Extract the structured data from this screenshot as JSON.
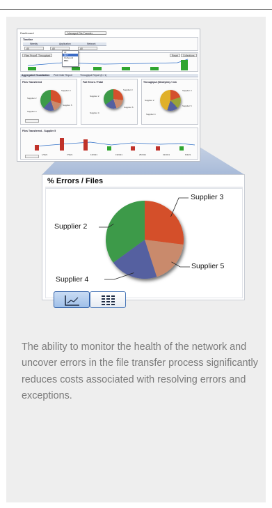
{
  "mini_dashboard": {
    "dashboard_label": "Dashboard",
    "dashboard_value": "Managed File Transfer",
    "timeline_label": "Timeline",
    "filter_tabs": [
      "Weekly",
      "Application",
      "Network"
    ],
    "filter_selects": [
      "All",
      "All",
      "All"
    ],
    "dropdown_options": [
      "All",
      "MFT",
      "Outbound Files",
      "EDI"
    ],
    "chart_tabs": [
      "Files Processed",
      "Throughput"
    ],
    "chart_chips": [
      "Reset",
      "Collections"
    ],
    "section_tabs": [
      "Aggregated Visualization",
      "Ped Order Report",
      "Throughput Report (6 / 1)"
    ],
    "pie_titles": [
      "Files Transferred",
      "Full Errors / Fatal",
      "Throughput (Kilobytes) / min"
    ],
    "pie_labels": [
      "Supplier 2",
      "Supplier 3",
      "Supplier 4",
      "Supplier 5"
    ],
    "bottom_title": "Files Transferred - Supplier 5",
    "bottom_ticks": [
      "1/3/21",
      "7/3/21",
      "13/3/21",
      "19/3/21",
      "25/3/21",
      "31/3/21",
      "6/4/21"
    ]
  },
  "widget": {
    "title": "% Errors / Files",
    "chart_data": {
      "type": "pie",
      "title": "% Errors / Files",
      "slices": [
        {
          "name": "Supplier 3",
          "value": 27,
          "color": "#d4502c"
        },
        {
          "name": "Supplier 5",
          "value": 18,
          "color": "#c98a6c"
        },
        {
          "name": "Supplier 4",
          "value": 20,
          "color": "#5460a0"
        },
        {
          "name": "Supplier 2",
          "value": 35,
          "color": "#3c9a48"
        }
      ]
    },
    "view_buttons": [
      {
        "icon": "line-chart-icon",
        "active": true
      },
      {
        "icon": "table-grid-icon",
        "active": false
      }
    ]
  },
  "description": "The ability to monitor the health of the network and uncover errors in the file transfer process significantly reduces costs associated with resolving errors and exceptions.",
  "colors": {
    "panel": "#eeeeee",
    "beam": "#b7c6de",
    "accent": "#4a78b8"
  }
}
